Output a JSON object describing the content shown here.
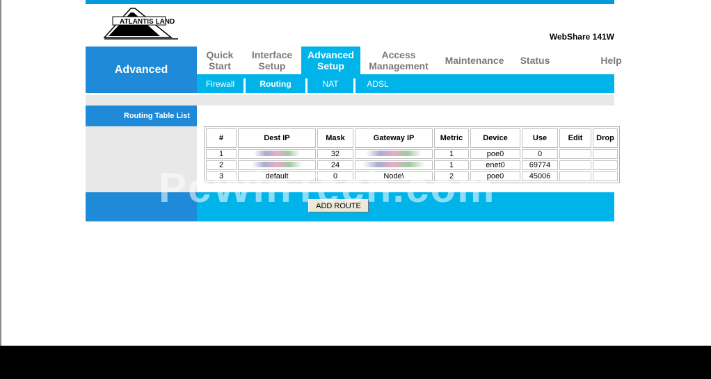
{
  "brand": {
    "logo_text": "ATLANTIS LAND",
    "product_name": "WebShare 141W"
  },
  "section_title": "Advanced",
  "menu": [
    {
      "label": "Quick\nStart"
    },
    {
      "label": "Interface\nSetup"
    },
    {
      "label": "Advanced\nSetup"
    },
    {
      "label": "Access\nManagement"
    },
    {
      "label": "Maintenance"
    },
    {
      "label": "Status"
    },
    {
      "label": "Help"
    }
  ],
  "submenu": [
    {
      "label": "Firewall"
    },
    {
      "label": "Routing"
    },
    {
      "label": "NAT"
    },
    {
      "label": "ADSL"
    }
  ],
  "sidebar": {
    "title": "Routing Table List"
  },
  "routing_table": {
    "headers": [
      "#",
      "Dest IP",
      "Mask",
      "Gateway IP",
      "Metric",
      "Device",
      "Use",
      "Edit",
      "Drop"
    ],
    "rows": [
      {
        "num": "1",
        "dest": "",
        "mask": "32",
        "gateway": "",
        "metric": "1",
        "device": "poe0",
        "use": "0"
      },
      {
        "num": "2",
        "dest": "",
        "mask": "24",
        "gateway": "",
        "metric": "1",
        "device": "enet0",
        "use": "69774"
      },
      {
        "num": "3",
        "dest": "default",
        "mask": "0",
        "gateway": "Node\\",
        "metric": "2",
        "device": "poe0",
        "use": "45006"
      }
    ]
  },
  "buttons": {
    "add_route": "ADD ROUTE"
  },
  "watermark": "PcWinTech.com",
  "colors": {
    "dark_blue": "#1e8ad8",
    "light_blue": "#00b4ea",
    "gray": "#e8e8e8"
  }
}
